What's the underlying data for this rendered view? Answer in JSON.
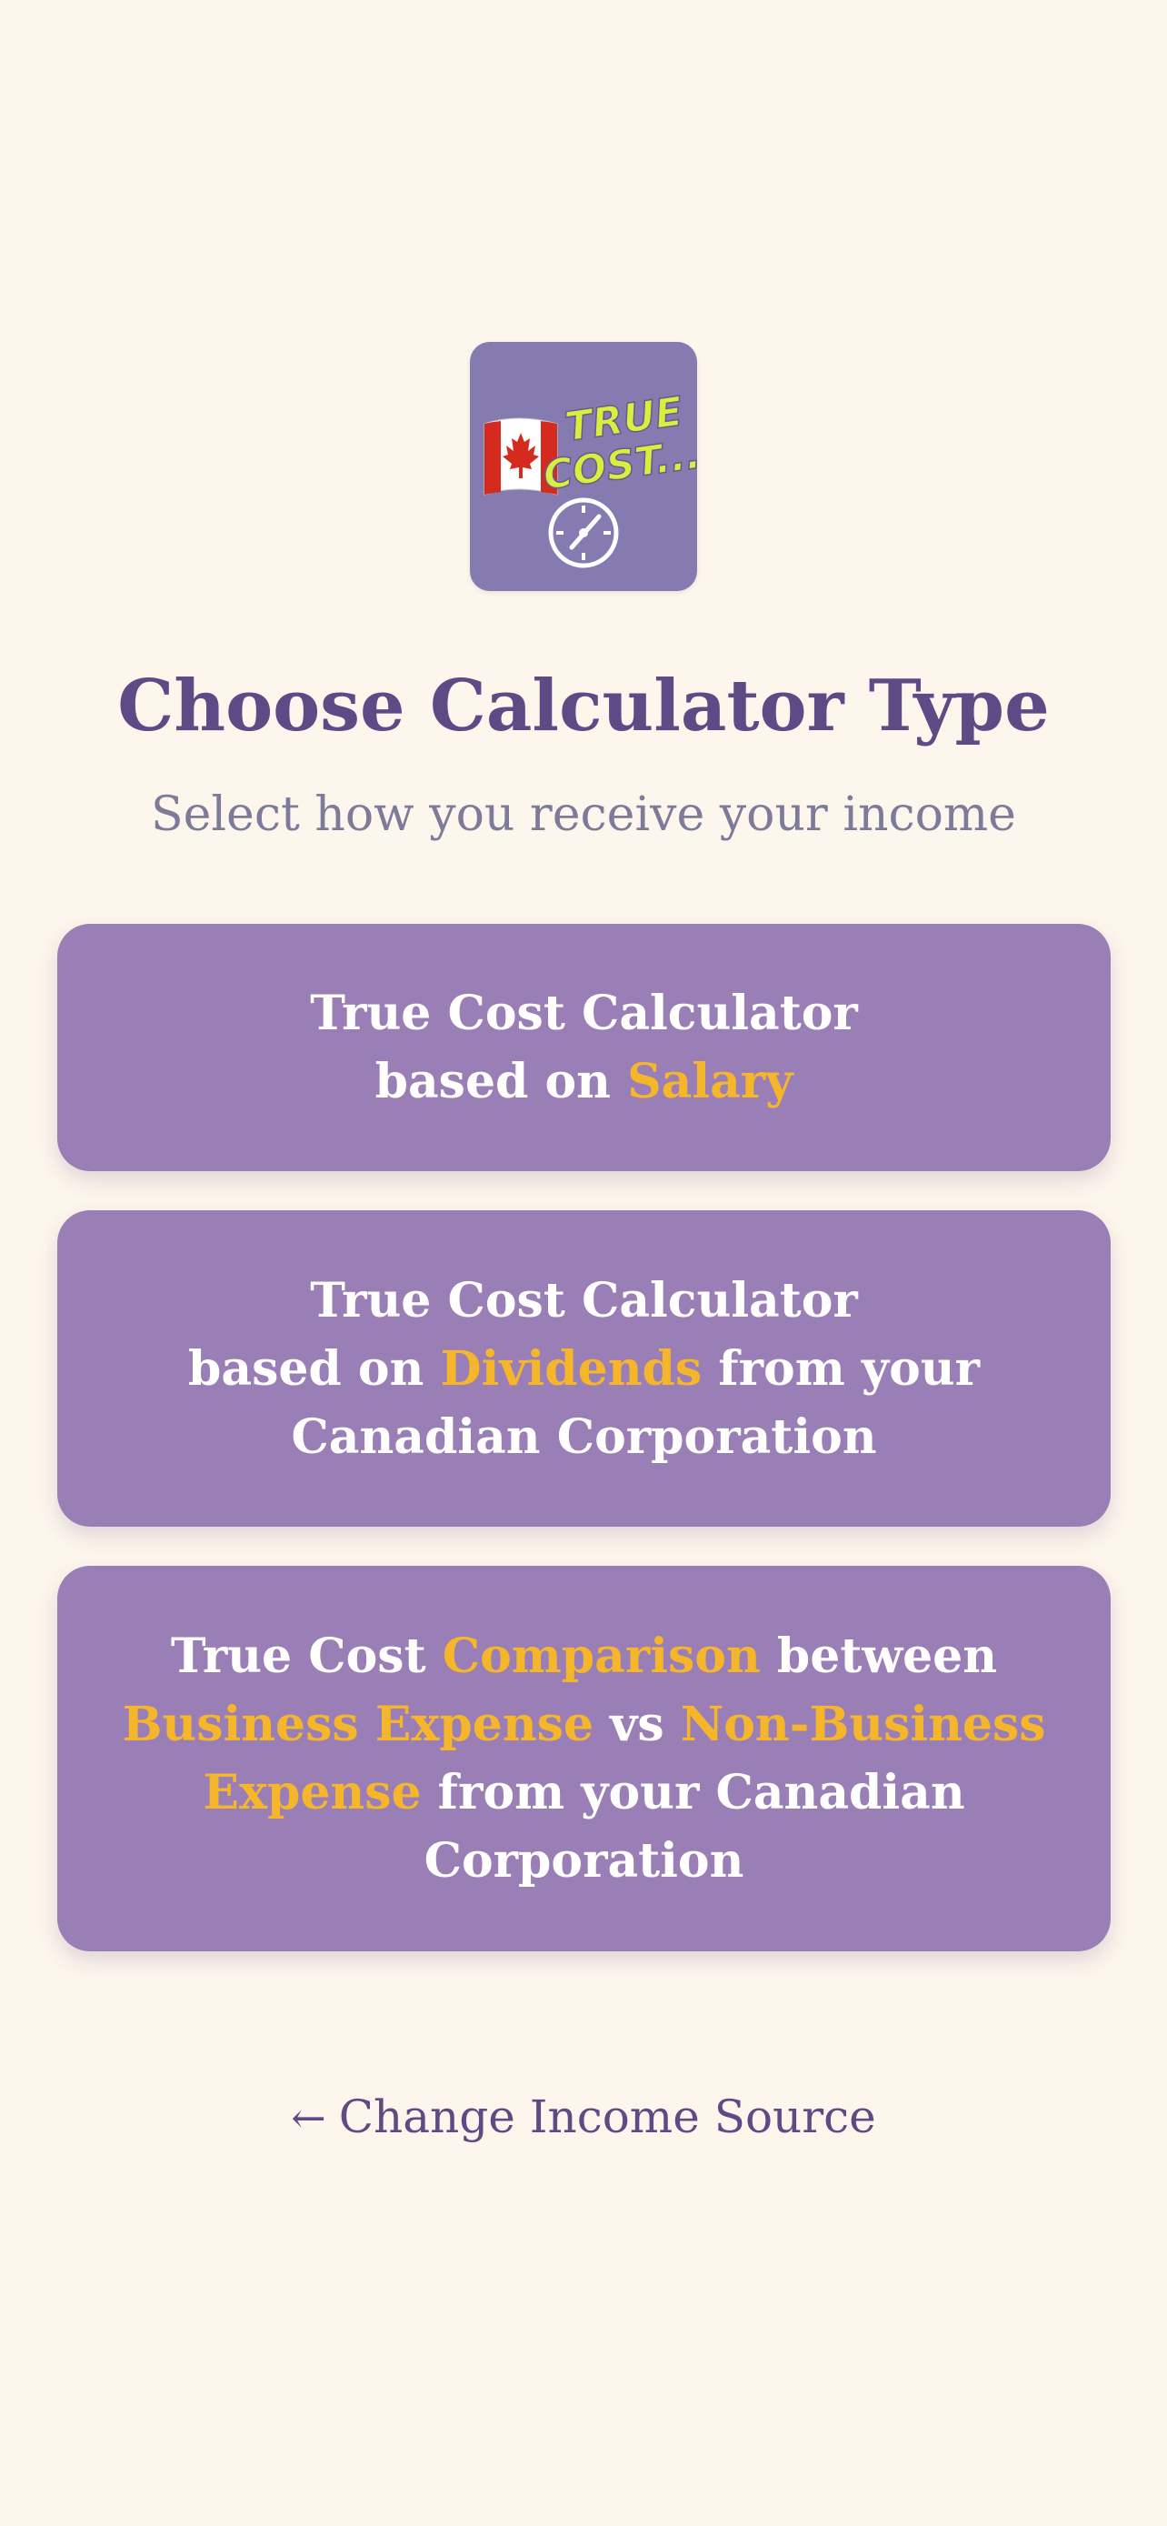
{
  "logo": {
    "text_line1": "TRUE",
    "text_line2": "COST...",
    "flag_icon": "canada-flag-icon",
    "gauge_icon": "speedometer-icon",
    "colors": {
      "background": "#857bb0",
      "text": "#d9ef3e",
      "flag_red": "#d52b1e"
    }
  },
  "header": {
    "title": "Choose Calculator Type",
    "subtitle": "Select how you receive your income"
  },
  "options": [
    {
      "parts": [
        {
          "text": "True Cost Calculator",
          "highlight": false,
          "break_after": true
        },
        {
          "text": "based on ",
          "highlight": false
        },
        {
          "text": "Salary",
          "highlight": true
        }
      ]
    },
    {
      "parts": [
        {
          "text": "True Cost Calculator",
          "highlight": false,
          "break_after": true
        },
        {
          "text": "based on ",
          "highlight": false
        },
        {
          "text": "Dividends",
          "highlight": true
        },
        {
          "text": " from your",
          "highlight": false,
          "break_after": true
        },
        {
          "text": "Canadian Corporation",
          "highlight": false
        }
      ]
    },
    {
      "parts": [
        {
          "text": "True Cost ",
          "highlight": false
        },
        {
          "text": "Comparison",
          "highlight": true
        },
        {
          "text": " between",
          "highlight": false,
          "break_after": true
        },
        {
          "text": "Business Expense",
          "highlight": true
        },
        {
          "text": " vs ",
          "highlight": false
        },
        {
          "text": "Non-Business",
          "highlight": true,
          "break_after": true
        },
        {
          "text": "Expense",
          "highlight": true
        },
        {
          "text": " from your Canadian",
          "highlight": false,
          "break_after": true
        },
        {
          "text": "Corporation",
          "highlight": false
        }
      ]
    }
  ],
  "footer": {
    "back_arrow_icon": "left-arrow-icon",
    "back_arrow": "←",
    "back_label": "Change Income Source"
  },
  "colors": {
    "page_background": "#fdf6ec",
    "title": "#5e4a85",
    "subtitle": "#7e7a9a",
    "card": "#9a7eb6",
    "card_text": "#ffffff",
    "highlight": "#f6b62b"
  }
}
